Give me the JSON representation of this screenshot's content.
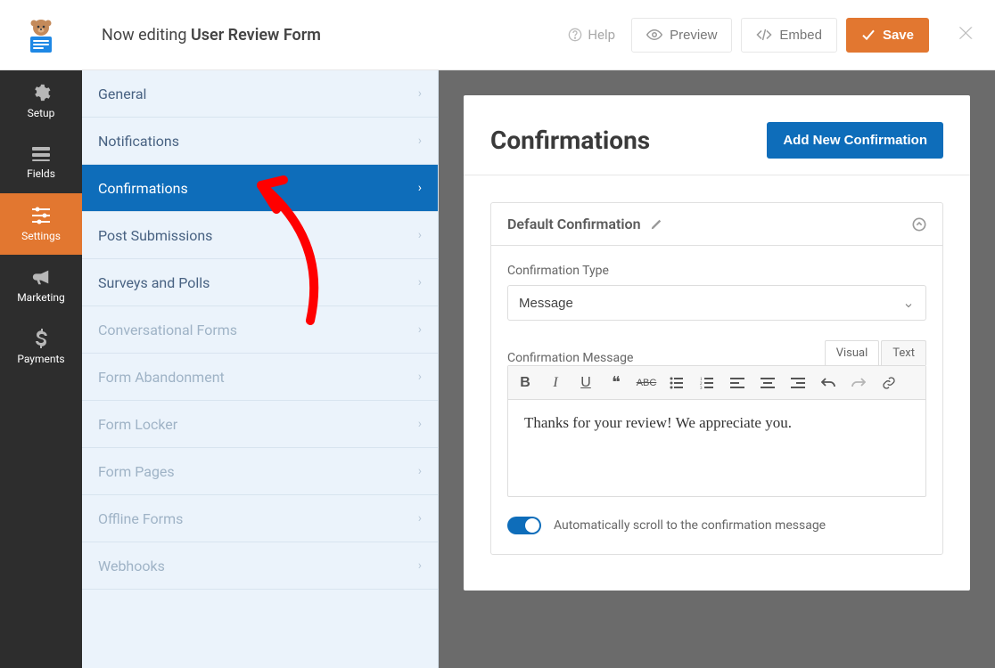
{
  "topbar": {
    "editing_prefix": "Now editing ",
    "form_name": "User Review Form",
    "help": "Help",
    "preview": "Preview",
    "embed": "Embed",
    "save": "Save"
  },
  "leftnav": {
    "items": [
      {
        "id": "setup",
        "label": "Setup"
      },
      {
        "id": "fields",
        "label": "Fields"
      },
      {
        "id": "settings",
        "label": "Settings"
      },
      {
        "id": "marketing",
        "label": "Marketing"
      },
      {
        "id": "payments",
        "label": "Payments"
      }
    ]
  },
  "subnav": {
    "items": [
      {
        "id": "general",
        "label": "General",
        "state": "normal"
      },
      {
        "id": "notifications",
        "label": "Notifications",
        "state": "normal"
      },
      {
        "id": "confirmations",
        "label": "Confirmations",
        "state": "active"
      },
      {
        "id": "post-submissions",
        "label": "Post Submissions",
        "state": "normal"
      },
      {
        "id": "surveys-polls",
        "label": "Surveys and Polls",
        "state": "normal"
      },
      {
        "id": "conversational-forms",
        "label": "Conversational Forms",
        "state": "disabled"
      },
      {
        "id": "form-abandonment",
        "label": "Form Abandonment",
        "state": "disabled"
      },
      {
        "id": "form-locker",
        "label": "Form Locker",
        "state": "disabled"
      },
      {
        "id": "form-pages",
        "label": "Form Pages",
        "state": "disabled"
      },
      {
        "id": "offline-forms",
        "label": "Offline Forms",
        "state": "disabled"
      },
      {
        "id": "webhooks",
        "label": "Webhooks",
        "state": "disabled"
      }
    ]
  },
  "content": {
    "title": "Confirmations",
    "add_button": "Add New Confirmation",
    "card": {
      "title": "Default Confirmation",
      "type_label": "Confirmation Type",
      "type_value": "Message",
      "message_label": "Confirmation Message",
      "tabs": {
        "visual": "Visual",
        "text": "Text"
      },
      "message_body": "Thanks for your review! We appreciate you.",
      "autoscroll_label": "Automatically scroll to the confirmation message",
      "autoscroll_on": true
    }
  }
}
